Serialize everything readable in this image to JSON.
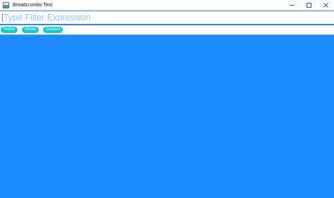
{
  "window": {
    "title": "Breadcrumbs Test"
  },
  "filter": {
    "placeholder": "Type Filter Expression",
    "value": ""
  },
  "breadcrumbs": [
    {
      "label": "Home"
    },
    {
      "label": "About"
    },
    {
      "label": "Contact"
    }
  ],
  "icons": {
    "app": "app-window-icon",
    "minimize": "minimize-icon",
    "maximize": "maximize-icon",
    "close": "close-icon"
  },
  "colors": {
    "content_background": "#1e8cff",
    "breadcrumb_pill": "#18c8c8",
    "input_border": "#2a86e8",
    "placeholder": "#96c7ee"
  }
}
